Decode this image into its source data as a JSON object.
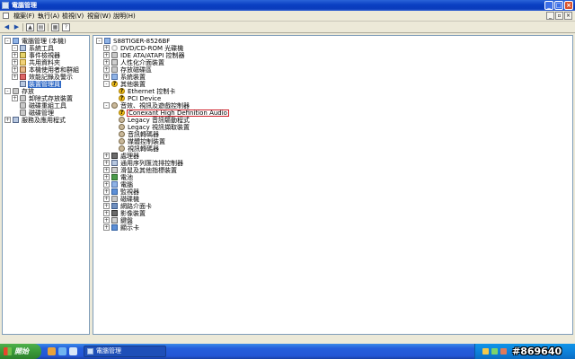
{
  "window": {
    "title": "電腦管理"
  },
  "menu": [
    "檔案(F)",
    "執行(A)",
    "檢視(V)",
    "視窗(W)",
    "說明(H)"
  ],
  "toolbar": {
    "icons": [
      "back-arrow-icon",
      "forward-arrow-icon",
      "up-folder-icon",
      "show-tree-icon",
      "properties-icon",
      "help-icon"
    ]
  },
  "left_tree": [
    {
      "label": "電腦管理 (本機)",
      "icon": "computer-icon",
      "expander": "-"
    },
    {
      "label": "系統工具",
      "icon": "tools-icon",
      "expander": "-"
    },
    {
      "label": "事件檢視器",
      "icon": "event-viewer-icon",
      "expander": "+"
    },
    {
      "label": "共用資料夾",
      "icon": "shared-folder-icon",
      "expander": "+"
    },
    {
      "label": "本機使用者和群組",
      "icon": "users-icon",
      "expander": "+"
    },
    {
      "label": "效能記錄及警示",
      "icon": "performance-icon",
      "expander": "+"
    },
    {
      "label": "裝置管理員",
      "icon": "device-manager-icon",
      "expander": "",
      "selected": true
    },
    {
      "label": "存放",
      "icon": "storage-icon",
      "expander": "-"
    },
    {
      "label": "卸除式存放裝置",
      "icon": "removable-storage-icon",
      "expander": "+"
    },
    {
      "label": "磁碟重組工具",
      "icon": "defrag-icon",
      "expander": ""
    },
    {
      "label": "磁碟管理",
      "icon": "disk-management-icon",
      "expander": ""
    },
    {
      "label": "服務及應用程式",
      "icon": "services-icon",
      "expander": "+"
    }
  ],
  "right_tree": [
    {
      "label": "S88TIGER-8526BF",
      "icon": "computer-icon",
      "expander": "-"
    },
    {
      "label": "DVD/CD-ROM 光碟機",
      "icon": "cdrom-icon",
      "expander": "+"
    },
    {
      "label": "IDE ATA/ATAPI 控制器",
      "icon": "ide-controller-icon",
      "expander": "+"
    },
    {
      "label": "人性化介面裝置",
      "icon": "hid-icon",
      "expander": "+"
    },
    {
      "label": "存放磁碟區",
      "icon": "volume-icon",
      "expander": "+"
    },
    {
      "label": "系統裝置",
      "icon": "system-device-icon",
      "expander": "+"
    },
    {
      "label": "其他裝置",
      "icon": "warning-icon",
      "expander": "-"
    },
    {
      "label": "Ethernet 控制卡",
      "icon": "warning-icon",
      "expander": ""
    },
    {
      "label": "PCI Device",
      "icon": "warning-icon",
      "expander": ""
    },
    {
      "label": "音效、視訊及遊戲控制器",
      "icon": "sound-icon",
      "expander": "-"
    },
    {
      "label": "Conexant High Definition Audio",
      "icon": "warning-icon",
      "expander": "",
      "highlight": true
    },
    {
      "label": "Legacy 音訊驅動程式",
      "icon": "sound-icon",
      "expander": ""
    },
    {
      "label": "Legacy 視訊擷取裝置",
      "icon": "sound-icon",
      "expander": ""
    },
    {
      "label": "音訊轉碼器",
      "icon": "sound-icon",
      "expander": ""
    },
    {
      "label": "媒體控制裝置",
      "icon": "sound-icon",
      "expander": ""
    },
    {
      "label": "視訊轉碼器",
      "icon": "sound-icon",
      "expander": ""
    },
    {
      "label": "處理器",
      "icon": "processor-icon",
      "expander": "+"
    },
    {
      "label": "通用序列匯流排控制器",
      "icon": "usb-icon",
      "expander": "+"
    },
    {
      "label": "滑鼠及其他指標裝置",
      "icon": "mouse-icon",
      "expander": "+"
    },
    {
      "label": "電池",
      "icon": "battery-icon",
      "expander": "+"
    },
    {
      "label": "電腦",
      "icon": "computer-icon",
      "expander": "+"
    },
    {
      "label": "監視器",
      "icon": "monitor-icon",
      "expander": "+"
    },
    {
      "label": "磁碟機",
      "icon": "disk-drive-icon",
      "expander": "+"
    },
    {
      "label": "網路介面卡",
      "icon": "network-adapter-icon",
      "expander": "+"
    },
    {
      "label": "影像裝置",
      "icon": "imaging-icon",
      "expander": "+"
    },
    {
      "label": "鍵盤",
      "icon": "keyboard-icon",
      "expander": "+"
    },
    {
      "label": "顯示卡",
      "icon": "display-adapter-icon",
      "expander": "+"
    }
  ],
  "taskbar": {
    "start_label": "開始",
    "task_label": "電腦管理",
    "watermark": "#869640"
  },
  "colors": {
    "titlebar": "#0a3fc2",
    "selection": "#316ac5",
    "highlight_border": "#d0202a",
    "start_green": "#3a9a39"
  }
}
